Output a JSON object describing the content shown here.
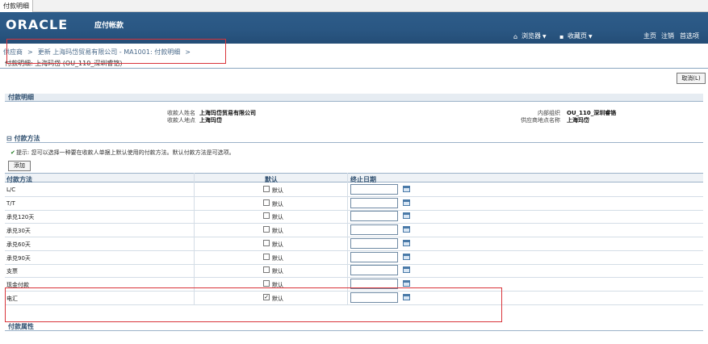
{
  "window": {
    "tab_label": "付款明细"
  },
  "header": {
    "logo": "ORACLE",
    "app_title": "应付帐款",
    "browser_menu": "浏览器",
    "favorites_menu": "收藏页",
    "home_link": "主页",
    "logout_link": "注销",
    "preferences_link": "首选项"
  },
  "breadcrumb": {
    "items": [
      "供应商",
      "更新 上海玛岱贸易有限公司 - MA1001: 付款明细"
    ],
    "separator": ">"
  },
  "page": {
    "title": "付款明细: 上海玛岱 (OU_110_深圳睿铬)",
    "cancel_button": "取消(L)"
  },
  "details": {
    "section_title": "付款明细",
    "payee_name_label": "收款人姓名",
    "payee_name": "上海玛岱贸易有限公司",
    "payee_site_label": "收款人地点",
    "payee_site": "上海玛岱",
    "org_label": "内部组织",
    "org": "OU_110_深圳睿铬",
    "supplier_site_label": "供应商地点名称",
    "supplier_site": "上海玛岱"
  },
  "payment_methods": {
    "section_title": "付款方法",
    "tip": "提示: 您可以选择一种要在收款人单据上默认使用的付款方法。默认付款方法是可选项。",
    "add_button": "添加",
    "columns": [
      "付款方法",
      "默认",
      "终止日期"
    ],
    "default_label": "默认",
    "rows": [
      {
        "method": "L/C",
        "default": false,
        "end_date": ""
      },
      {
        "method": "T/T",
        "default": false,
        "end_date": ""
      },
      {
        "method": "承兑120天",
        "default": false,
        "end_date": ""
      },
      {
        "method": "承兑30天",
        "default": false,
        "end_date": ""
      },
      {
        "method": "承兑60天",
        "default": false,
        "end_date": ""
      },
      {
        "method": "承兑90天",
        "default": false,
        "end_date": ""
      },
      {
        "method": "支票",
        "default": false,
        "end_date": ""
      },
      {
        "method": "现金付款",
        "default": false,
        "end_date": ""
      },
      {
        "method": "电汇",
        "default": true,
        "end_date": ""
      }
    ]
  },
  "attributes": {
    "section_title": "付款属性"
  },
  "colors": {
    "banner": "#2a5783",
    "annotation": "#d9343a",
    "section_text": "#2e4e6e"
  }
}
